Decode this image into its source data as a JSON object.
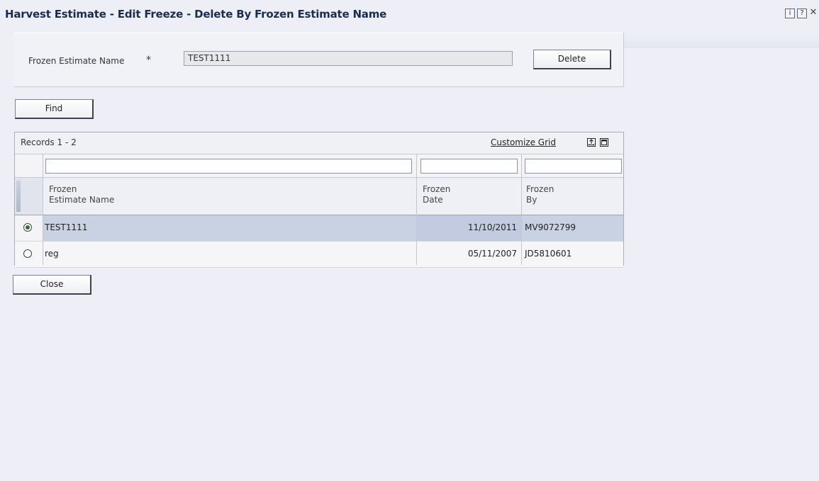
{
  "window": {
    "title": "Harvest Estimate - Edit Freeze - Delete By Frozen Estimate Name",
    "icons": [
      "info-icon",
      "help-icon",
      "close-icon"
    ],
    "icon_glyphs": [
      "i",
      "?",
      "✕"
    ]
  },
  "filter": {
    "label": "Frozen Estimate Name",
    "required_mark": "*",
    "value": "TEST1111",
    "delete_label": "Delete"
  },
  "find_label": "Find",
  "grid": {
    "records_label": "Records 1 - 2",
    "customize_label": "Customize Grid",
    "columns": [
      {
        "line1": "Frozen",
        "line2": "Estimate Name"
      },
      {
        "line1": "Frozen",
        "line2": "Date"
      },
      {
        "line1": "Frozen",
        "line2": "By"
      }
    ],
    "rows": [
      {
        "name": "TEST1111",
        "date": "11/10/2011",
        "by": "MV9072799",
        "selected": true
      },
      {
        "name": "reg",
        "date": "05/11/2007",
        "by": "JD5810601",
        "selected": false
      }
    ]
  },
  "close_label": "Close",
  "colors": {
    "title": "#1b2d4f",
    "background": "#eeeef6",
    "selected_row": "#c9d2e3"
  }
}
